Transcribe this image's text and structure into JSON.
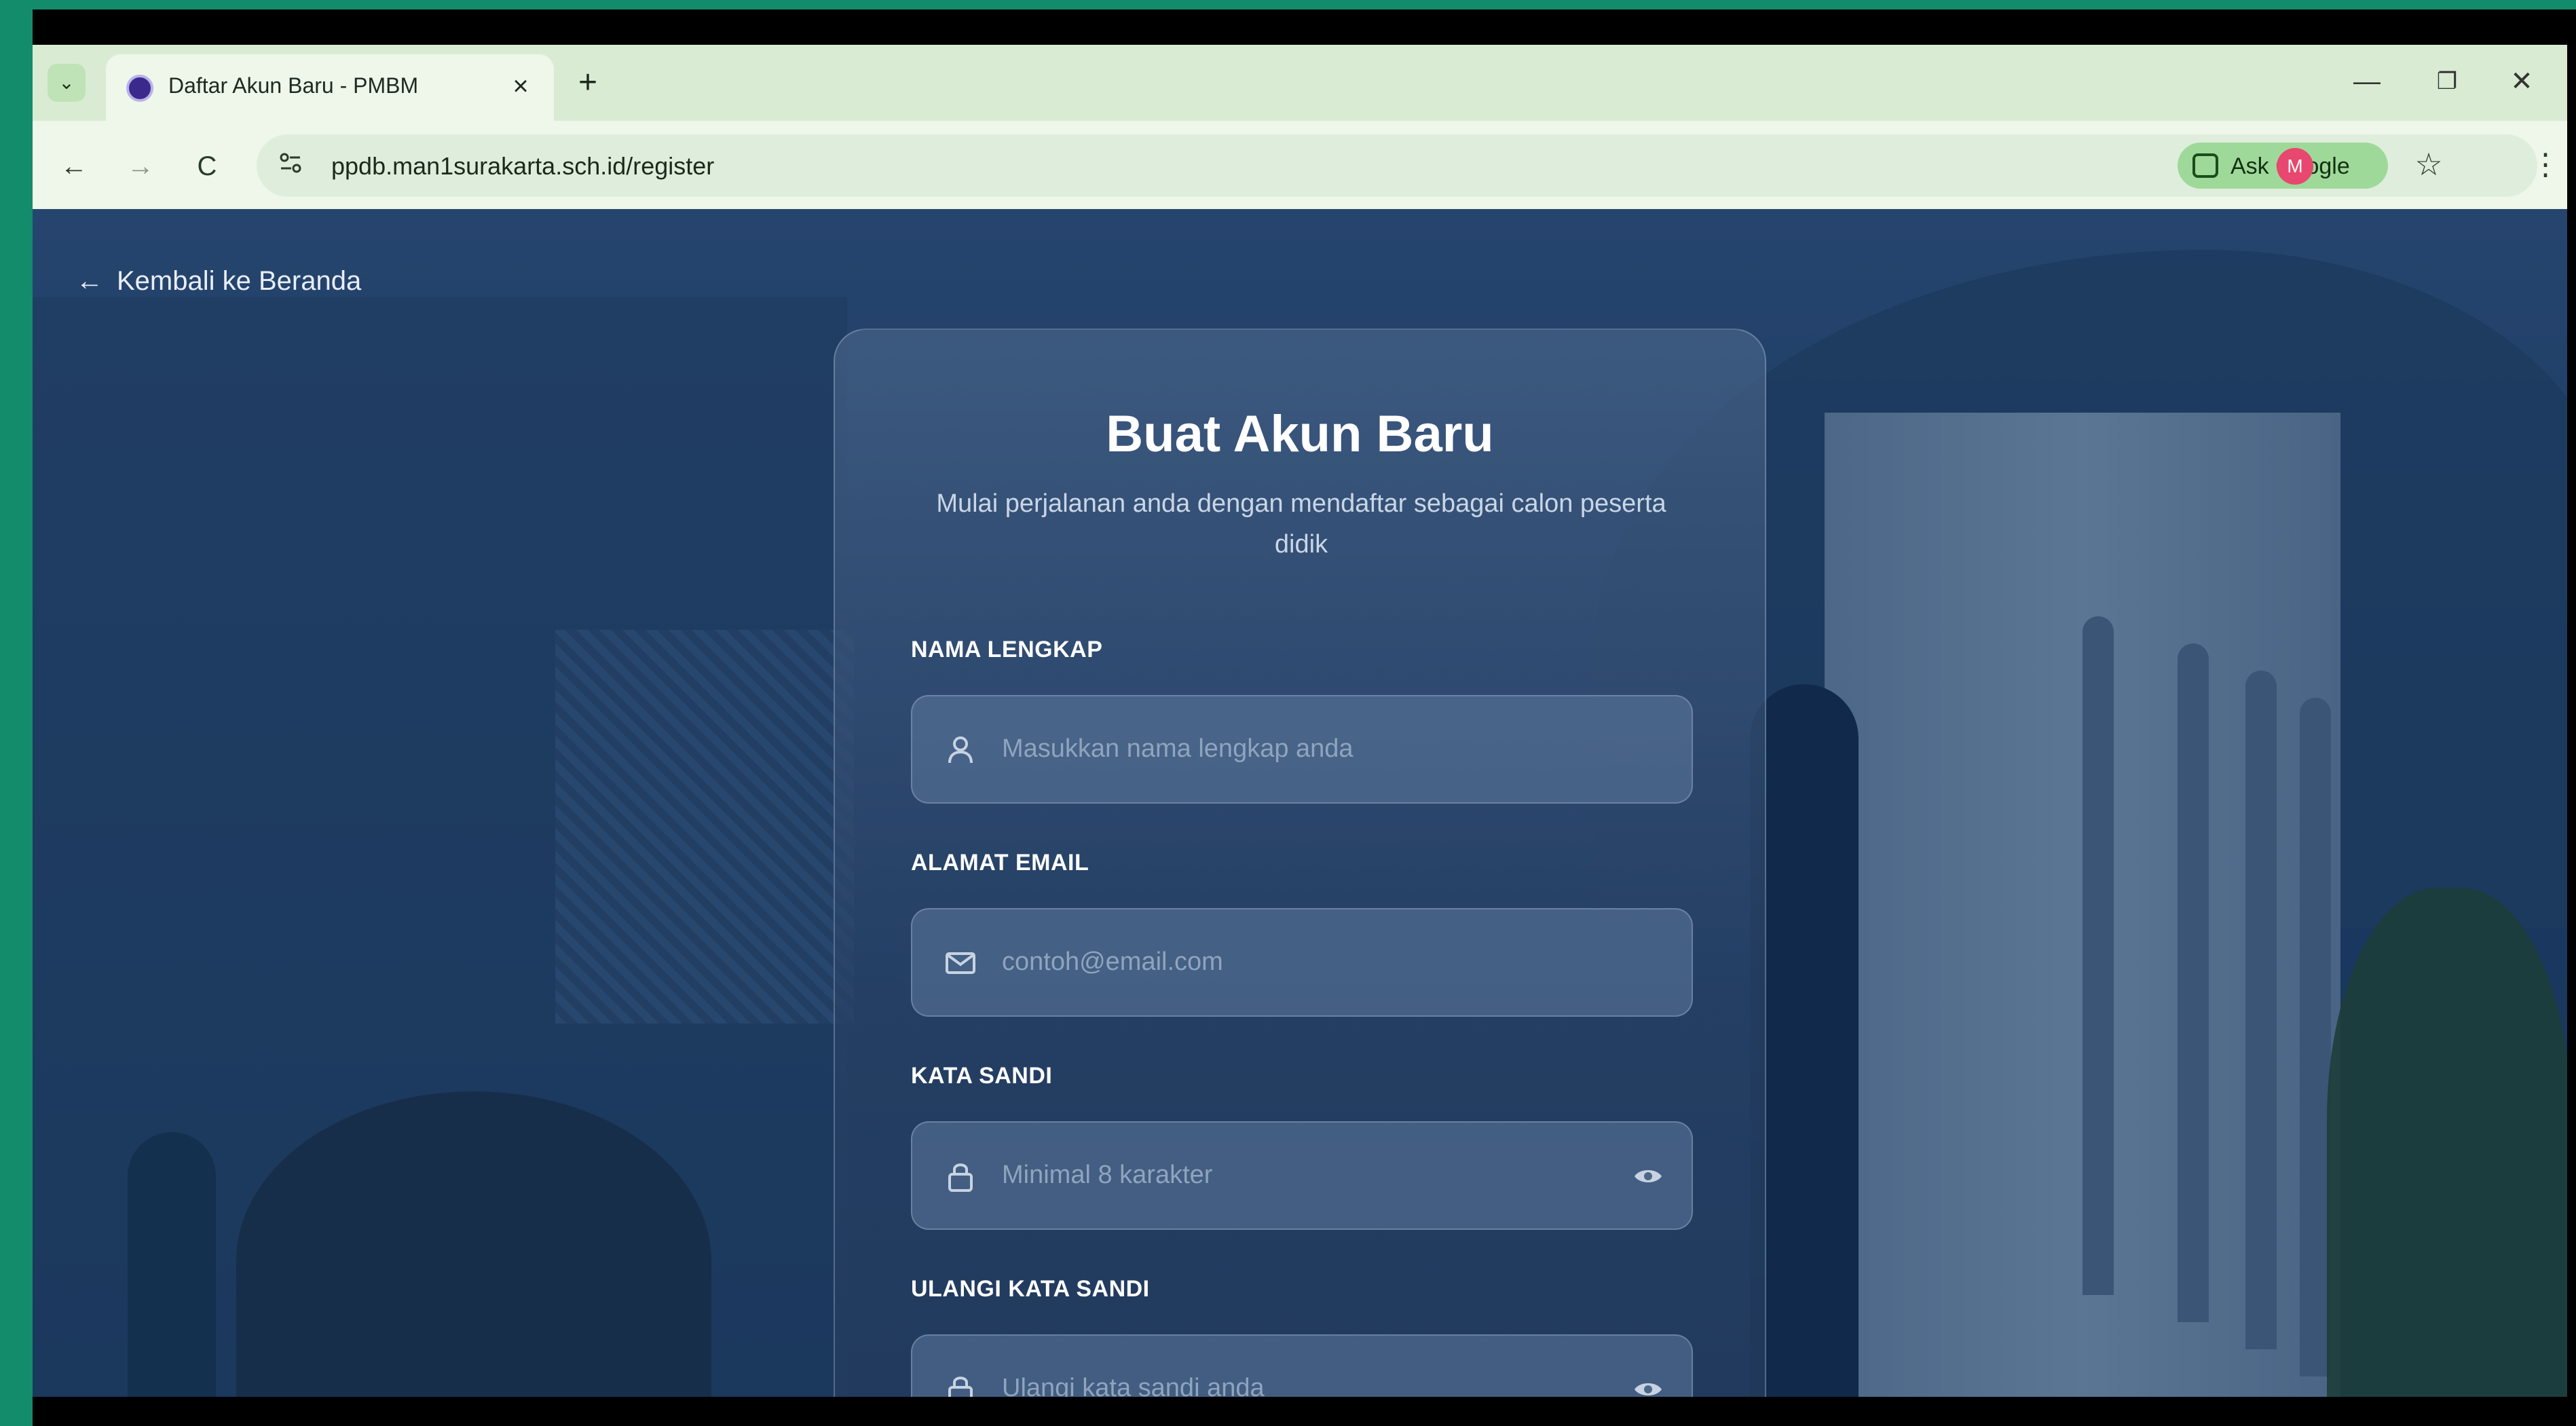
{
  "browser": {
    "tab_title": "Daftar Akun Baru - PMBM",
    "tab_close": "×",
    "new_tab": "+",
    "tab_menu": "⌄",
    "window": {
      "minimize": "—",
      "restore": "❐",
      "close": "✕"
    },
    "nav": {
      "back": "←",
      "forward": "→",
      "reload": "C"
    },
    "url": "ppdb.man1surakarta.sch.id/register",
    "ask_google_label": "Ask Google",
    "bookmark_star": "☆",
    "profile_initial": "M",
    "menu": "⋮"
  },
  "page": {
    "back_link": "Kembali ke Beranda",
    "back_arrow": "←",
    "title": "Buat Akun Baru",
    "subtitle": "Mulai perjalanan anda dengan mendaftar sebagai calon peserta didik",
    "fields": [
      {
        "label": "NAMA LENGKAP",
        "placeholder": "Masukkan nama lengkap anda",
        "icon": "user-icon"
      },
      {
        "label": "ALAMAT EMAIL",
        "placeholder": "contoh@email.com",
        "icon": "mail-icon"
      },
      {
        "label": "KATA SANDI",
        "placeholder": "Minimal 8 karakter",
        "icon": "lock-icon",
        "toggle_icon": "eye-icon"
      },
      {
        "label": "ULANGI KATA SANDI",
        "placeholder": "Ulangi kata sandi anda",
        "icon": "lock-icon",
        "toggle_icon": "eye-icon"
      }
    ]
  },
  "colors": {
    "frame_green": "#128c6a",
    "tab_strip": "#d9ecd3",
    "ask_google_bg": "#9fd99a",
    "profile_avatar": "#e8476f",
    "page_bg": "#1c3a62"
  }
}
